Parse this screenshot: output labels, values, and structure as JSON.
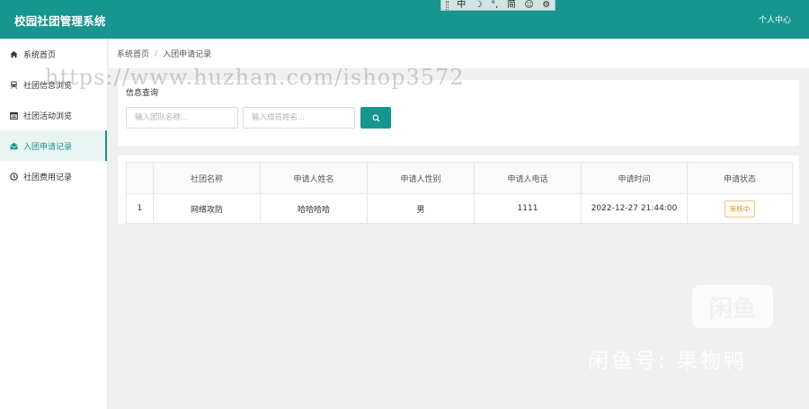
{
  "header": {
    "app_title": "校园社团管理系统",
    "user_center": "个人中心"
  },
  "ime_bar": {
    "items": [
      {
        "label": "中",
        "icon": "chinese-mode-icon"
      },
      {
        "label": "☽",
        "icon": "half-width-moon-icon"
      },
      {
        "label": "°,",
        "icon": "punctuation-icon"
      },
      {
        "label": "简",
        "icon": "simplified-icon"
      },
      {
        "label": "☺",
        "icon": "emoji-icon"
      },
      {
        "label": "⚙",
        "icon": "gear-icon"
      }
    ]
  },
  "sidebar": {
    "items": [
      {
        "label": "系统首页",
        "icon": "home-icon",
        "active": false
      },
      {
        "label": "社团信息浏览",
        "icon": "train-icon",
        "active": false
      },
      {
        "label": "社团活动浏览",
        "icon": "calendar-icon",
        "active": false
      },
      {
        "label": "入团申请记录",
        "icon": "envelope-open-icon",
        "active": true
      },
      {
        "label": "社团费用记录",
        "icon": "clock-icon",
        "active": false
      }
    ]
  },
  "breadcrumb": {
    "home": "系统首页",
    "separator": "/",
    "current": "入团申请记录"
  },
  "search": {
    "title": "信息查询",
    "club_placeholder": "输入团队名称...",
    "member_placeholder": "输入成员姓名...",
    "button_icon": "search-icon"
  },
  "table": {
    "columns": [
      "",
      "社团名称",
      "申请人姓名",
      "申请人性别",
      "申请人电话",
      "申请时间",
      "申请状态"
    ],
    "rows": [
      {
        "index": "1",
        "club_name": "网络攻防",
        "applicant_name": "哈哈哈哈",
        "gender": "男",
        "phone": "1111",
        "apply_time": "2022-12-27 21:44:00",
        "status": "审核中"
      }
    ]
  },
  "overlays": {
    "watermark_url": "https://www.huzhan.com/ishop3572",
    "xianyu_logo": "闲鱼",
    "xianyu_id": "闲鱼号: 果物鸭"
  },
  "colors": {
    "primary": "#17958f",
    "active_bg": "#e9f4f3",
    "status_pending": "#d39a3c"
  }
}
